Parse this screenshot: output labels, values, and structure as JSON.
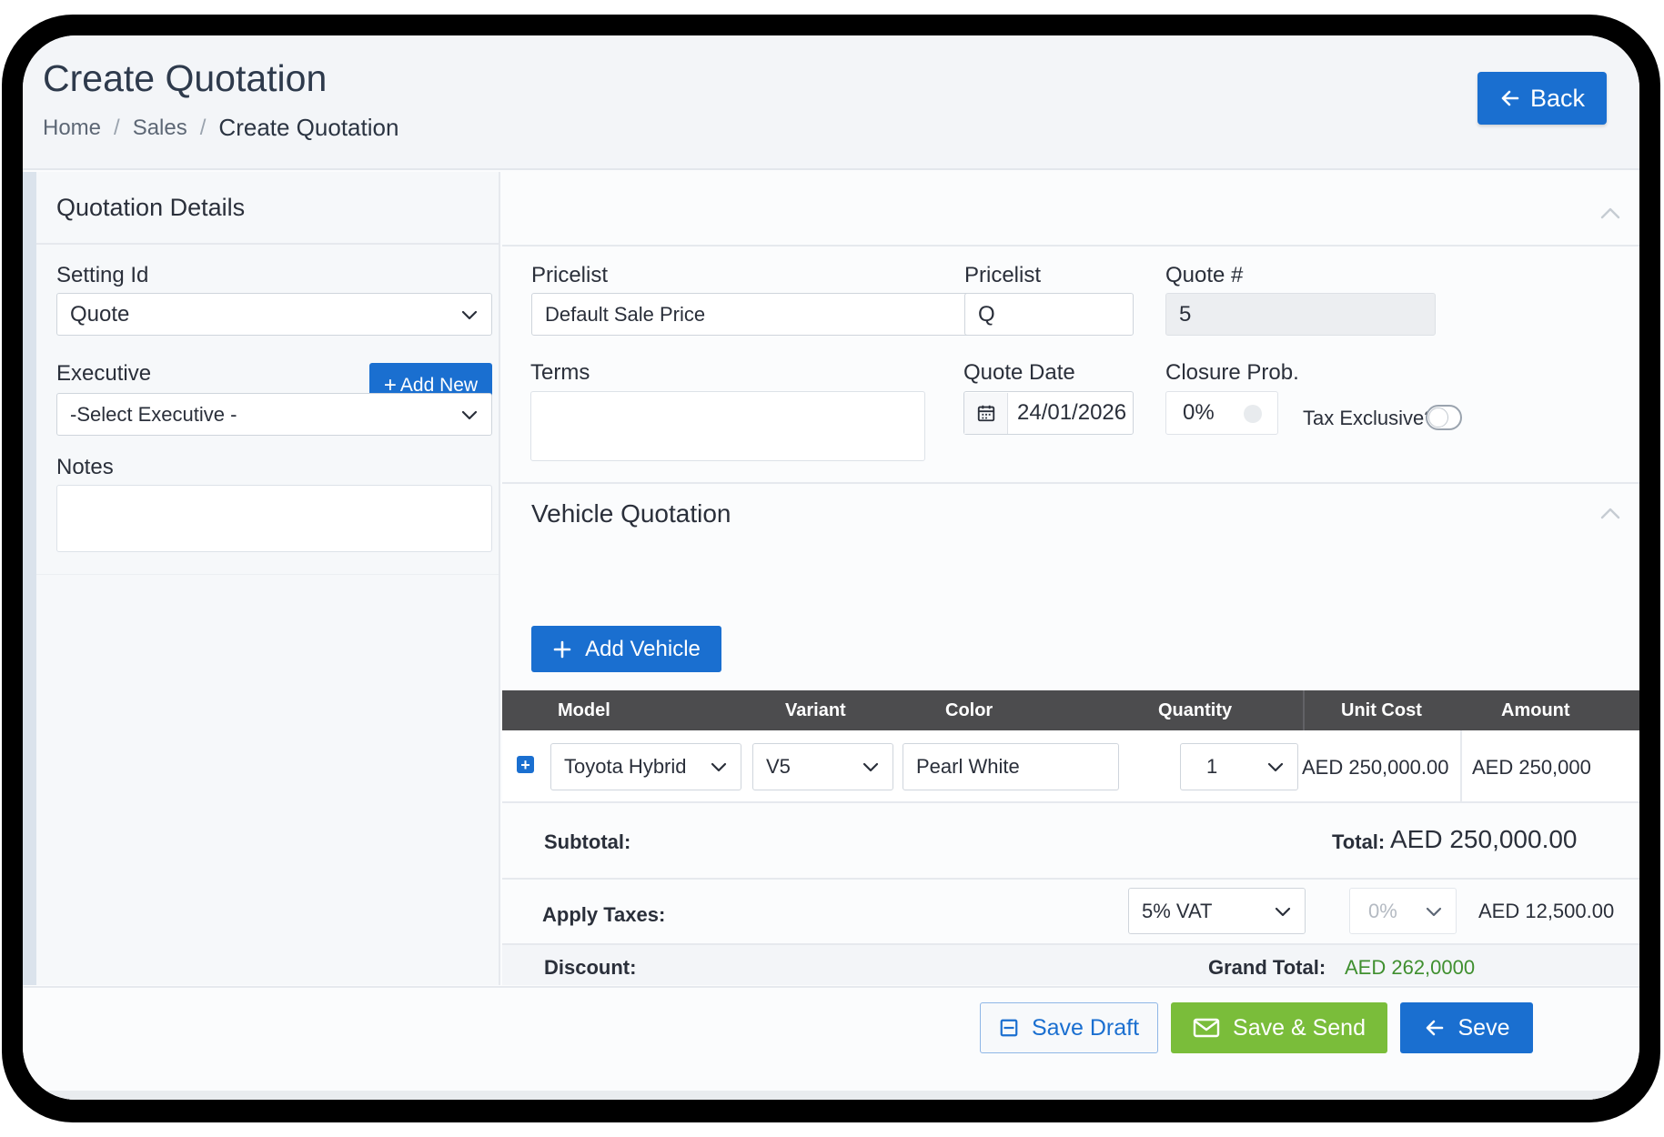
{
  "header": {
    "title": "Create Quotation",
    "breadcrumb": [
      "Home",
      "Sales",
      "Create Quotation"
    ],
    "back_label": "Back"
  },
  "left": {
    "section_title": "Quotation Details",
    "setting_id_label": "Setting Id",
    "setting_id_value": "Quote",
    "executive_label": "Executive",
    "add_new_label": "Add New",
    "executive_value": "-Select Executive -",
    "notes_label": "Notes",
    "notes_value": ""
  },
  "details": {
    "pricelist_label": "Pricelist",
    "pricelist_value": "Default Sale Price",
    "pricelist2_label": "Pricelist",
    "pricelist2_value": "Q",
    "quote_no_label": "Quote #",
    "quote_no_value": "5",
    "terms_label": "Terms",
    "terms_value": "",
    "quote_date_label": "Quote Date",
    "quote_date_value": "24/01/2026",
    "closure_label": "Closure Prob.",
    "closure_value": "0%",
    "tax_exclusive_label": "Tax Exclusive?",
    "tax_exclusive_on": false
  },
  "vehicle": {
    "section_title": "Vehicle Quotation",
    "add_vehicle_label": "Add Vehicle",
    "columns": [
      "Model",
      "Variant",
      "Color",
      "Quantity",
      "Unit Cost",
      "Amount"
    ],
    "rows": [
      {
        "model": "Toyota Hybrid",
        "variant": "V5",
        "color": "Pearl White",
        "quantity": "1",
        "unit_cost": "AED 250,000.00",
        "amount": "AED 250,000"
      }
    ]
  },
  "summary": {
    "subtotal_label": "Subtotal:",
    "total_label": "Total:",
    "total_value": "AED 250,000.00",
    "apply_taxes_label": "Apply Taxes:",
    "tax_select": "5% VAT",
    "tax_percent": "0%",
    "tax_amount": "AED 12,500.00",
    "discount_label": "Discount:",
    "grand_total_label": "Grand Total:",
    "grand_total_value": "AED 262,0000"
  },
  "footer": {
    "save_draft_label": "Save Draft",
    "save_send_label": "Save & Send",
    "seve_label": "Seve"
  },
  "colors": {
    "primary": "#1a6fd0",
    "success": "#7abd3a",
    "table_header": "#4c4c4e",
    "grand_total_text": "#3f8f2f"
  }
}
